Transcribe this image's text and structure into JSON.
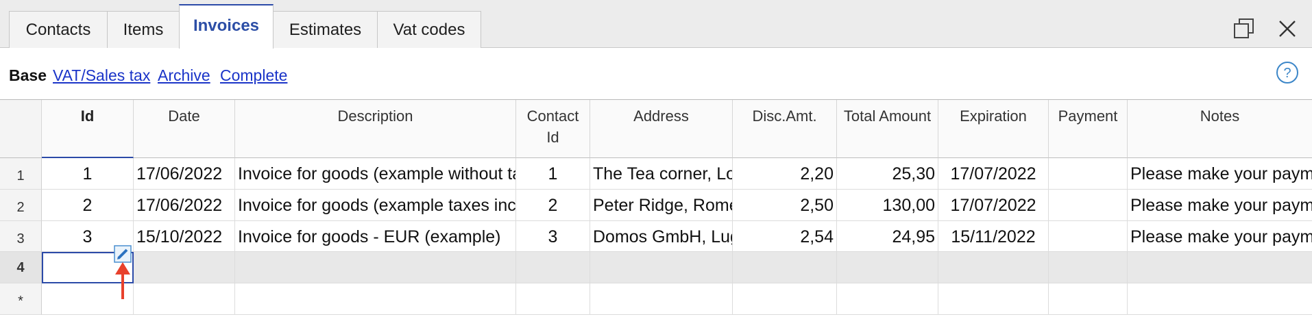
{
  "tabs": [
    {
      "label": "Contacts",
      "active": false
    },
    {
      "label": "Items",
      "active": false
    },
    {
      "label": "Invoices",
      "active": true
    },
    {
      "label": "Estimates",
      "active": false
    },
    {
      "label": "Vat codes",
      "active": false
    }
  ],
  "views": {
    "current": "Base",
    "links": [
      "VAT/Sales tax",
      "Archive",
      "Complete"
    ]
  },
  "columns": [
    "Id",
    "Date",
    "Description",
    "Contact Id",
    "Address",
    "Disc.Amt.",
    "Total Amount",
    "Expiration",
    "Payment",
    "Notes"
  ],
  "rows": [
    {
      "num": "1",
      "id": "1",
      "date": "17/06/2022",
      "description": "Invoice for goods (example without taxes)",
      "contact_id": "1",
      "address": "The Tea corner, London",
      "disc_amt": "2,20",
      "total": "25,30",
      "expiration": "17/07/2022",
      "payment": "",
      "notes": "Please make your payment"
    },
    {
      "num": "2",
      "id": "2",
      "date": "17/06/2022",
      "description": "Invoice for goods (example taxes included)",
      "contact_id": "2",
      "address": "Peter Ridge, Rome",
      "disc_amt": "2,50",
      "total": "130,00",
      "expiration": "17/07/2022",
      "payment": "",
      "notes": "Please make your payment"
    },
    {
      "num": "3",
      "id": "3",
      "date": "15/10/2022",
      "description": "Invoice for goods - EUR (example)",
      "contact_id": "3",
      "address": "Domos GmbH, Lugano",
      "disc_amt": "2,54",
      "total": "24,95",
      "expiration": "15/11/2022",
      "payment": "",
      "notes": "Please make your payment"
    }
  ],
  "new_row_num": "4",
  "append_row_marker": "*",
  "icons": {
    "restore": "restore-window-icon",
    "close": "close-icon",
    "help": "help-circle-icon",
    "edit": "pencil-edit-icon",
    "pointer": "red-arrow-indicator"
  },
  "colors": {
    "accent": "#2b4aa8",
    "link": "#1a34c8",
    "annotation": "#e8412c"
  }
}
